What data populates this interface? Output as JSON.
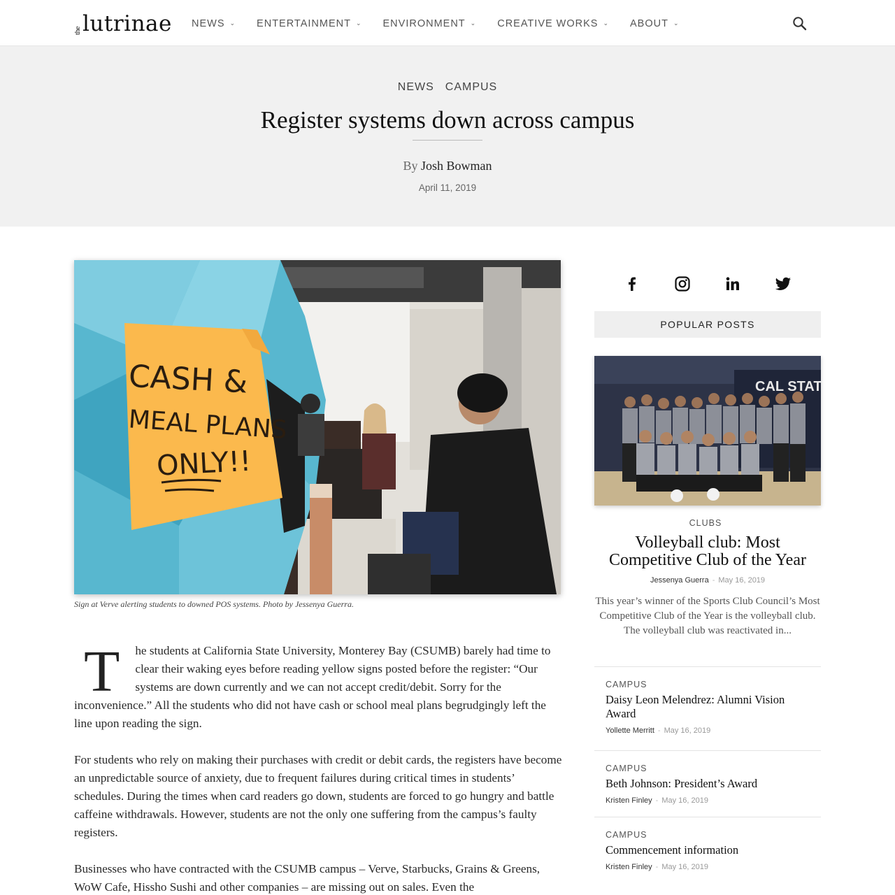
{
  "header": {
    "logo_small": "the",
    "logo_main": "lutrinae",
    "nav": [
      {
        "label": "NEWS"
      },
      {
        "label": "ENTERTAINMENT"
      },
      {
        "label": "ENVIRONMENT"
      },
      {
        "label": "CREATIVE WORKS"
      },
      {
        "label": "ABOUT"
      }
    ]
  },
  "article": {
    "categories": [
      "NEWS",
      "CAMPUS"
    ],
    "title": "Register systems down across campus",
    "by_label": "By",
    "author": "Josh Bowman",
    "date": "April 11, 2019",
    "sign_lines": [
      "CASH &",
      "MEAL PLANS",
      "ONLY!!"
    ],
    "caption": "Sign at Verve alerting students to downed POS systems. Photo by Jessenya Guerra.",
    "dropcap": "T",
    "paragraphs": [
      "he students at California State University, Monterey Bay (CSUMB) barely had time to clear their waking eyes before reading yellow signs posted before the register: “Our systems are down currently and we can not accept credit/debit. Sorry for the inconvenience.” All the students who did not have cash or school meal plans begrudgingly left the line upon reading the sign.",
      "For students who rely on making their purchases with credit or debit cards, the registers have become an unpredictable source of anxiety, due to frequent failures during critical times in students’ schedules. During the times when card readers go down, students are forced to go hungry and battle caffeine withdrawals. However, students are not the only one suffering from the campus’s faulty registers.",
      "Businesses who have contracted with the CSUMB campus – Verve, Starbucks, Grains & Greens, WoW Cafe, Hissho Sushi and other companies – are missing out on sales. Even the"
    ]
  },
  "sidebar": {
    "social": [
      "facebook-icon",
      "instagram-icon",
      "linkedin-icon",
      "twitter-icon"
    ],
    "popular_header": "POPULAR POSTS",
    "featured": {
      "category": "CLUBS",
      "banner_text": "CAL STAT",
      "title": "Volleyball club: Most Competitive Club of the Year",
      "author": "Jessenya Guerra",
      "date": "May 16, 2019",
      "excerpt": "This year’s winner of the Sports Club Council’s Most Competitive Club of the Year is the volleyball club. The volleyball club was reactivated in..."
    },
    "posts": [
      {
        "category": "CAMPUS",
        "title": "Daisy Leon Melendrez: Alumni Vision Award",
        "author": "Yollette Merritt",
        "date": "May 16, 2019"
      },
      {
        "category": "CAMPUS",
        "title": "Beth Johnson: President’s Award",
        "author": "Kristen Finley",
        "date": "May 16, 2019"
      },
      {
        "category": "CAMPUS",
        "title": "Commencement information",
        "author": "Kristen Finley",
        "date": "May 16, 2019"
      }
    ]
  }
}
